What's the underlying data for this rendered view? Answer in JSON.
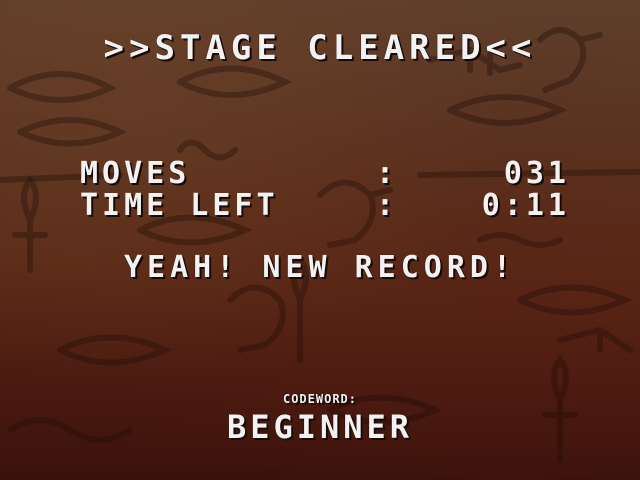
{
  "screen": {
    "title": ">>STAGE CLEARED<<",
    "stats": {
      "moves_label": "MOVES",
      "moves_colon": ":",
      "moves_value": "031",
      "time_label": "TIME LEFT",
      "time_colon": ":",
      "time_value": "0:11"
    },
    "record_message": "YEAH! NEW RECORD!",
    "codeword_label": "CODEWORD:",
    "codeword_value": "BEGINNER"
  },
  "colors": {
    "text": "#f2f2f2",
    "background_top": "#5e3e2b",
    "background_bottom": "#3a120b"
  },
  "icons": [
    "hieroglyph-eye-icon",
    "hieroglyph-bird-icon",
    "hieroglyph-hand-icon",
    "hieroglyph-ankh-icon"
  ]
}
